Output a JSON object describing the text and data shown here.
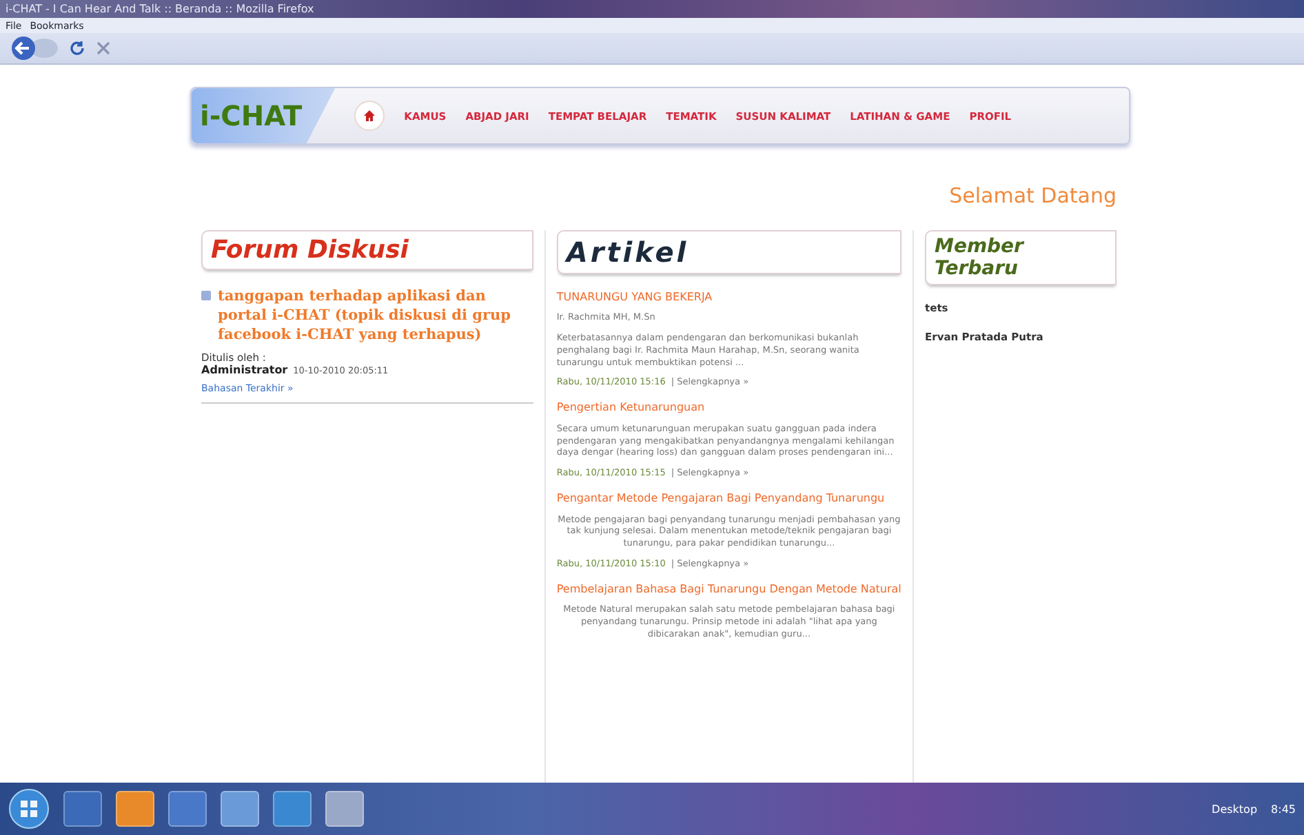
{
  "window": {
    "title": "i-CHAT - I Can Hear And Talk :: Beranda :: Mozilla Firefox"
  },
  "menu": [
    "File",
    "Bookmarks"
  ],
  "site": {
    "logo": "i-CHAT",
    "nav": [
      {
        "label": "KAMUS",
        "selected": false
      },
      {
        "label": "ABJAD JARI",
        "selected": false
      },
      {
        "label": "TEMPAT BELAJAR",
        "selected": false
      },
      {
        "label": "TEMATIK",
        "selected": false
      },
      {
        "label": "SUSUN KALIMAT",
        "selected": false
      },
      {
        "label": "LATIHAN & GAME",
        "selected": false
      },
      {
        "label": "PROFIL",
        "selected": false
      }
    ],
    "greeting": "Selamat Datang"
  },
  "forum": {
    "heading": "Forum Diskusi",
    "topic": "tanggapan terhadap aplikasi dan portal i-CHAT (topik diskusi di grup facebook i-CHAT yang terhapus)",
    "posted_by_label": "Ditulis oleh :",
    "author": "Administrator",
    "date": "10-10-2010 20:05:11",
    "more": "Bahasan Terakhir »"
  },
  "articles": {
    "heading": "Artikel",
    "items": [
      {
        "title": "TUNARUNGU YANG BEKERJA",
        "author": "Ir. Rachmita MH, M.Sn",
        "summary": "Keterbatasannya dalam pendengaran dan berkomunikasi bukanlah penghalang bagi Ir. Rachmita Maun Harahap, M.Sn, seorang wanita tunarungu untuk membuktikan potensi ...",
        "centered": false,
        "date": "Rabu, 10/11/2010 15:16",
        "more": "| Selengkapnya »"
      },
      {
        "title": "Pengertian Ketunarunguan",
        "summary": "Secara umum ketunarunguan merupakan suatu gangguan pada indera pendengaran yang mengakibatkan penyandangnya mengalami kehilangan daya dengar (hearing loss) dan gangguan dalam proses pendengaran ini...",
        "centered": false,
        "date": "Rabu, 10/11/2010 15:15",
        "more": "| Selengkapnya »"
      },
      {
        "title": "Pengantar Metode Pengajaran Bagi Penyandang Tunarungu",
        "summary": "Metode pengajaran bagi penyandang tunarungu menjadi pembahasan yang tak kunjung selesai. Dalam menentukan metode/teknik pengajaran bagi tunarungu, para pakar pendidikan tunarungu...",
        "centered": true,
        "date": "Rabu, 10/11/2010 15:10",
        "more": "| Selengkapnya »"
      },
      {
        "title": "Pembelajaran Bahasa Bagi Tunarungu Dengan Metode Natural",
        "summary": "Metode Natural merupakan salah satu metode pembelajaran bahasa bagi penyandang tunarungu. Prinsip metode ini adalah \"lihat apa yang dibicarakan anak\", kemudian guru...",
        "centered": true
      }
    ]
  },
  "members": {
    "heading": "Member Terbaru",
    "items": [
      "tets",
      "Ervan Pratada Putra"
    ]
  },
  "taskbar": {
    "desktop": "Desktop",
    "clock": "8:45"
  }
}
